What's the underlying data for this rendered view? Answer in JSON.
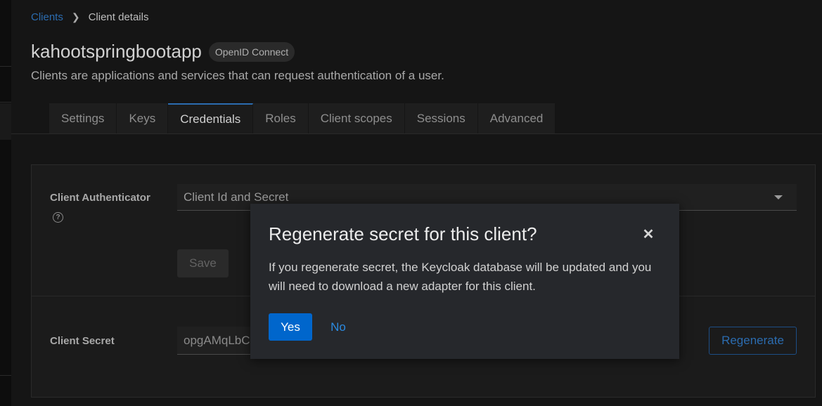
{
  "breadcrumb": {
    "parent": "Clients",
    "current": "Client details"
  },
  "header": {
    "title": "kahootspringbootapp",
    "badge": "OpenID Connect",
    "subtitle": "Clients are applications and services that can request authentication of a user."
  },
  "tabs": [
    {
      "label": "Settings"
    },
    {
      "label": "Keys"
    },
    {
      "label": "Credentials"
    },
    {
      "label": "Roles"
    },
    {
      "label": "Client scopes"
    },
    {
      "label": "Sessions"
    },
    {
      "label": "Advanced"
    }
  ],
  "active_tab": "Credentials",
  "form": {
    "authenticator_label": "Client Authenticator",
    "authenticator_value": "Client Id and Secret",
    "save_label": "Save",
    "secret_label": "Client Secret",
    "secret_value": "opgAMqLbC",
    "regenerate_label": "Regenerate"
  },
  "modal": {
    "title": "Regenerate secret for this client?",
    "body": "If you regenerate secret, the Keycloak database will be updated and you will need to download a new adapter for this client.",
    "yes_label": "Yes",
    "no_label": "No"
  },
  "colors": {
    "accent": "#0066cc",
    "link": "#2b6cb0",
    "background": "#151515",
    "modal_bg": "#26282c"
  }
}
